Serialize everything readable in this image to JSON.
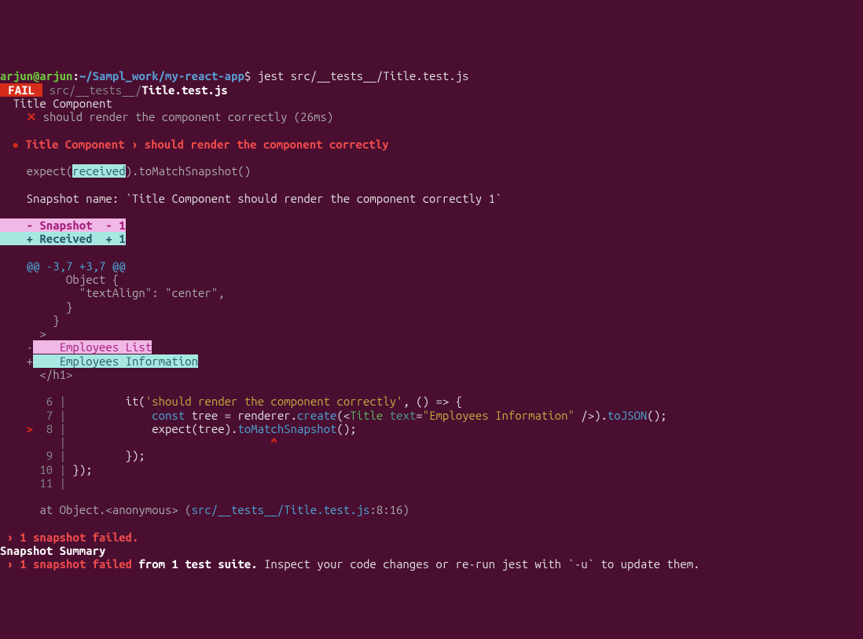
{
  "prompt": {
    "user": "arjun",
    "at": "@",
    "host": "arjun",
    "colon": ":",
    "path": "~/Sampl_work/my-react-app",
    "dollar": "$",
    "command": " jest src/__tests__/Title.test.js"
  },
  "fail_line": {
    "badge": " FAIL ",
    "path_grey": " src/__tests__/",
    "path_white": "Title.test.js"
  },
  "describe": {
    "title": "  Title Component",
    "cross": "    ✕",
    "test_text": " should render the component correctly (26ms)"
  },
  "bullet": {
    "icon": "  ●",
    "text": " Title Component › should render the component correctly"
  },
  "expect_line": {
    "pre": "    expect(",
    "received": "received",
    "post": ").toMatchSnapshot()"
  },
  "snapshot_name": "    Snapshot name: `Title Component should render the component correctly 1`",
  "diff_legend": {
    "minus": "    - Snapshot  - 1",
    "plus": "    + Received  + 1"
  },
  "diff": {
    "header": "    @@ -3,7 +3,7 @@",
    "l1": "          Object {",
    "l2": "            \"textAlign\": \"center\",",
    "l3": "          }",
    "l4": "        }",
    "l5": "      >",
    "minus_pre": "    -",
    "minus_text": "    Employees List",
    "plus_pre": "    +",
    "plus_text": "    Employees Information",
    "close": "      </h1>"
  },
  "code": {
    "r6_num": "       6 |",
    "r6_it": "         it(",
    "r6_str": "'should render the component correctly'",
    "r6_arrow": ", () => {",
    "r7_num": "       7 |",
    "r7_const": "             const",
    "r7_tree": " tree = renderer.",
    "r7_create": "create",
    "r7_open": "(<",
    "r7_title": "Title",
    "r7_text_attr": " text",
    "r7_eq": "=",
    "r7_val": "\"Employees Information\"",
    "r7_close": " />).",
    "r7_tojson": "toJSON",
    "r7_end": "();",
    "r8_ptr": "    >",
    "r8_num": "  8 |",
    "r8_expect": "             expect(tree).",
    "r8_match": "toMatchSnapshot",
    "r8_end": "();",
    "rblank_num": "         |",
    "rblank_caret_pre": "                               ",
    "rblank_caret": "^",
    "r9_num": "       9 |",
    "r9_text": "         });",
    "r10_num": "      10 |",
    "r10_text": " });",
    "r11_num": "      11 |"
  },
  "stack": {
    "pre": "      at Object.<anonymous> (",
    "link": "src/__tests__/Title.test.js",
    "post": ":8:16)"
  },
  "summary": {
    "arrow1": " ›",
    "s1": " 1 snapshot failed.",
    "heading": "Snapshot Summary",
    "arrow2": " ›",
    "s2a": " 1 snapshot failed",
    "s2b": " from 1 test suite.",
    "s2c": " Inspect your code changes or re-run jest with `-u` to update them."
  }
}
